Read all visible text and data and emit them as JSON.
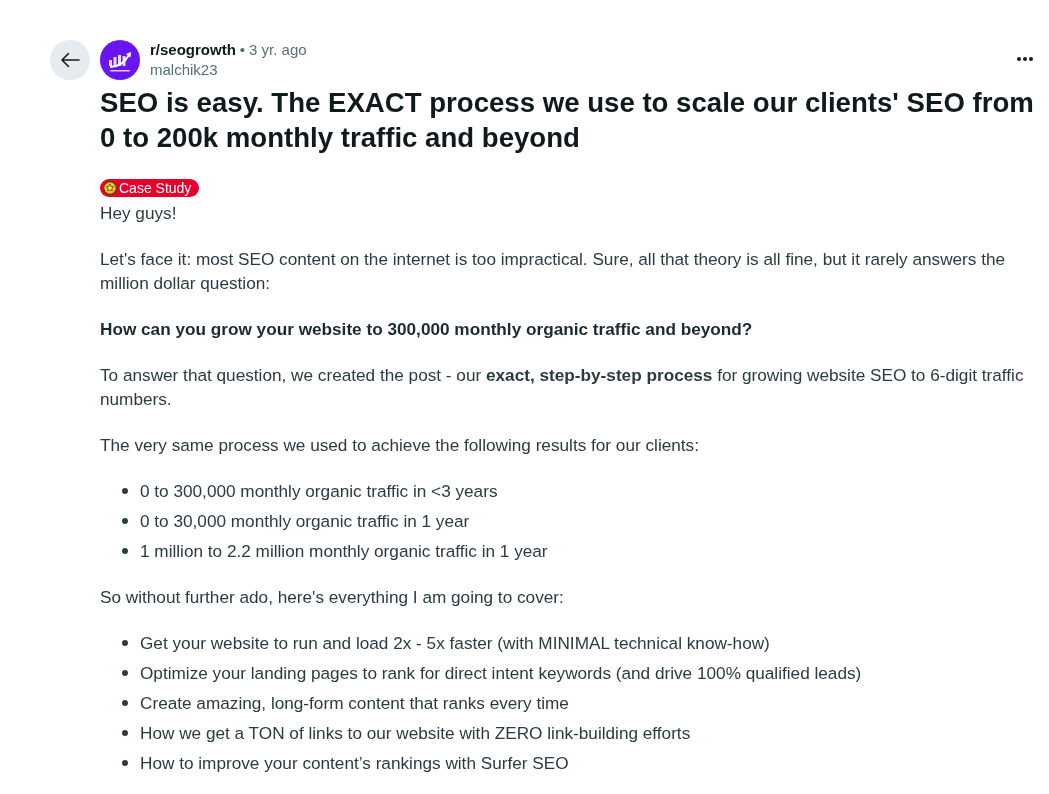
{
  "post": {
    "subreddit": "r/seogrowth",
    "separator": "•",
    "time": "3 yr. ago",
    "author": "malchik23",
    "title": "SEO is easy. The EXACT process we use to scale our clients' SEO from 0 to 200k monthly traffic and beyond",
    "flair": "Case Study",
    "body": [
      {
        "kind": "paragraph",
        "text": "Hey guys!"
      },
      {
        "kind": "paragraph",
        "text": "Let's face it: most SEO content on the internet is too impractical. Sure, all that theory is all fine, but it rarely answers the million dollar question:"
      },
      {
        "kind": "strong",
        "text": "How can you grow your website to 300,000 monthly organic traffic and beyond?"
      },
      {
        "kind": "paragraph",
        "text": "To answer that question, we created the post - our **exact, step-by-step process** for growing website SEO to 6-digit traffic numbers."
      },
      {
        "kind": "paragraph",
        "text": "The very same process we used to achieve the following results for our clients:"
      },
      {
        "kind": "list",
        "items": [
          "0 to 300,000 monthly organic traffic in <3 years",
          "0 to 30,000 monthly organic traffic in 1 year",
          "1 million to 2.2 million monthly organic traffic in 1 year"
        ]
      },
      {
        "kind": "paragraph",
        "text": "So without further ado, here's everything I am going to cover:"
      },
      {
        "kind": "list",
        "items": [
          "Get your website to run and load 2x - 5x faster (with MINIMAL technical know-how)",
          "Optimize your landing pages to rank for direct intent keywords (and drive 100% qualified leads)",
          "Create amazing, long-form content that ranks every time",
          "How we get a TON of links to our website with ZERO link-building efforts",
          "How to improve your content’s rankings with Surfer SEO"
        ]
      }
    ]
  }
}
